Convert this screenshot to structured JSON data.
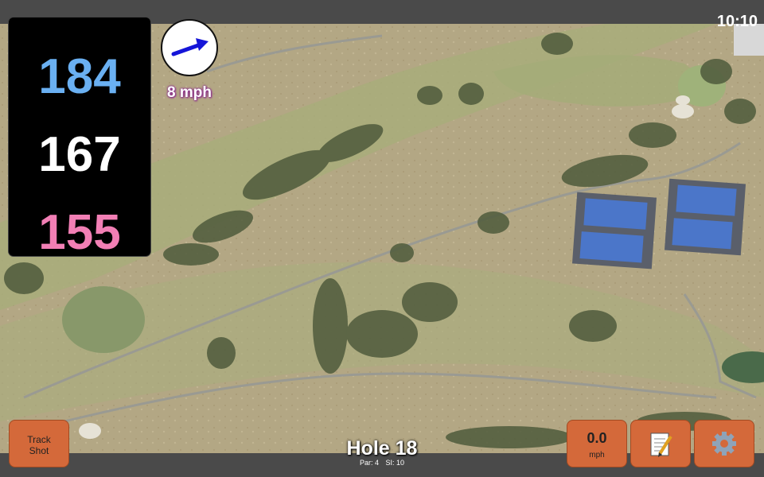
{
  "status": {
    "clock": "10:10"
  },
  "distances": {
    "back": "184",
    "middle": "167",
    "front": "155"
  },
  "wind": {
    "speed_label": "8 mph",
    "icon": "wind-direction-arrow-icon"
  },
  "hole": {
    "title": "Hole 18",
    "par_label": "Par: 4",
    "si_label": "SI: 10"
  },
  "buttons": {
    "track_line1": "Track",
    "track_line2": "Shot",
    "speed_value": "0.0",
    "speed_unit": "mph",
    "notes_icon": "notepad-icon",
    "settings_icon": "gear-icon"
  },
  "colors": {
    "back": "#6ab0f2",
    "middle": "#ffffff",
    "front": "#f27fb5",
    "button": "#d4693a"
  }
}
